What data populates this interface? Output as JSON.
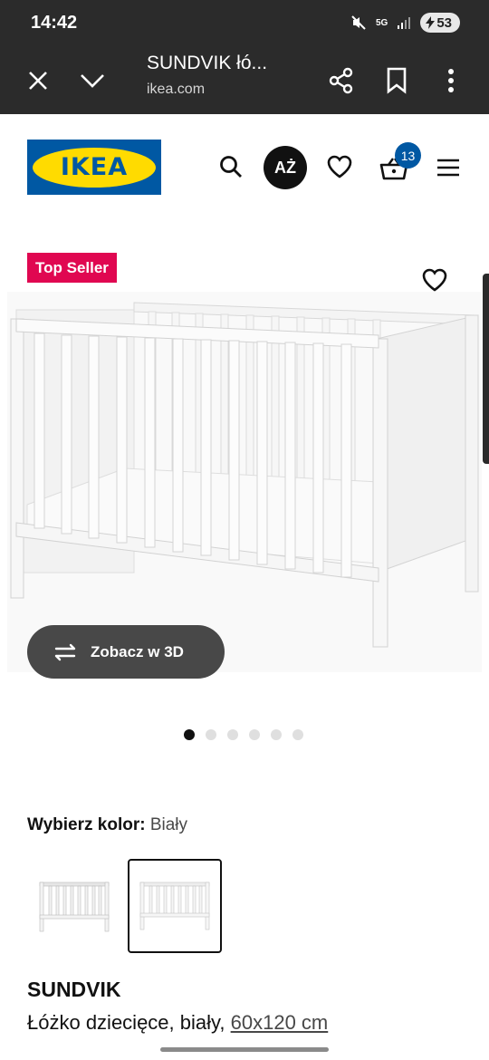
{
  "status_bar": {
    "time": "14:42",
    "network": "5G",
    "battery": "53"
  },
  "browser": {
    "title": "SUNDVIK łó...",
    "host": "ikea.com"
  },
  "site": {
    "logo_text": "IKEA",
    "language_button": "AŻ",
    "cart_count": "13"
  },
  "gallery": {
    "badge": "Top Seller",
    "view_3d_label": "Zobacz w 3D",
    "slide_count": 6,
    "active_slide": 1
  },
  "color": {
    "label": "Wybierz kolor:",
    "value": "Biały"
  },
  "product": {
    "name": "SUNDVIK",
    "description": "Łóżko dziecięce, biały,",
    "dimensions": "60x120 cm"
  },
  "colors": {
    "ikea_blue": "#0058a3",
    "ikea_yellow": "#ffdb00",
    "badge_red": "#e00751",
    "browser_bar": "#2b2b2b"
  }
}
